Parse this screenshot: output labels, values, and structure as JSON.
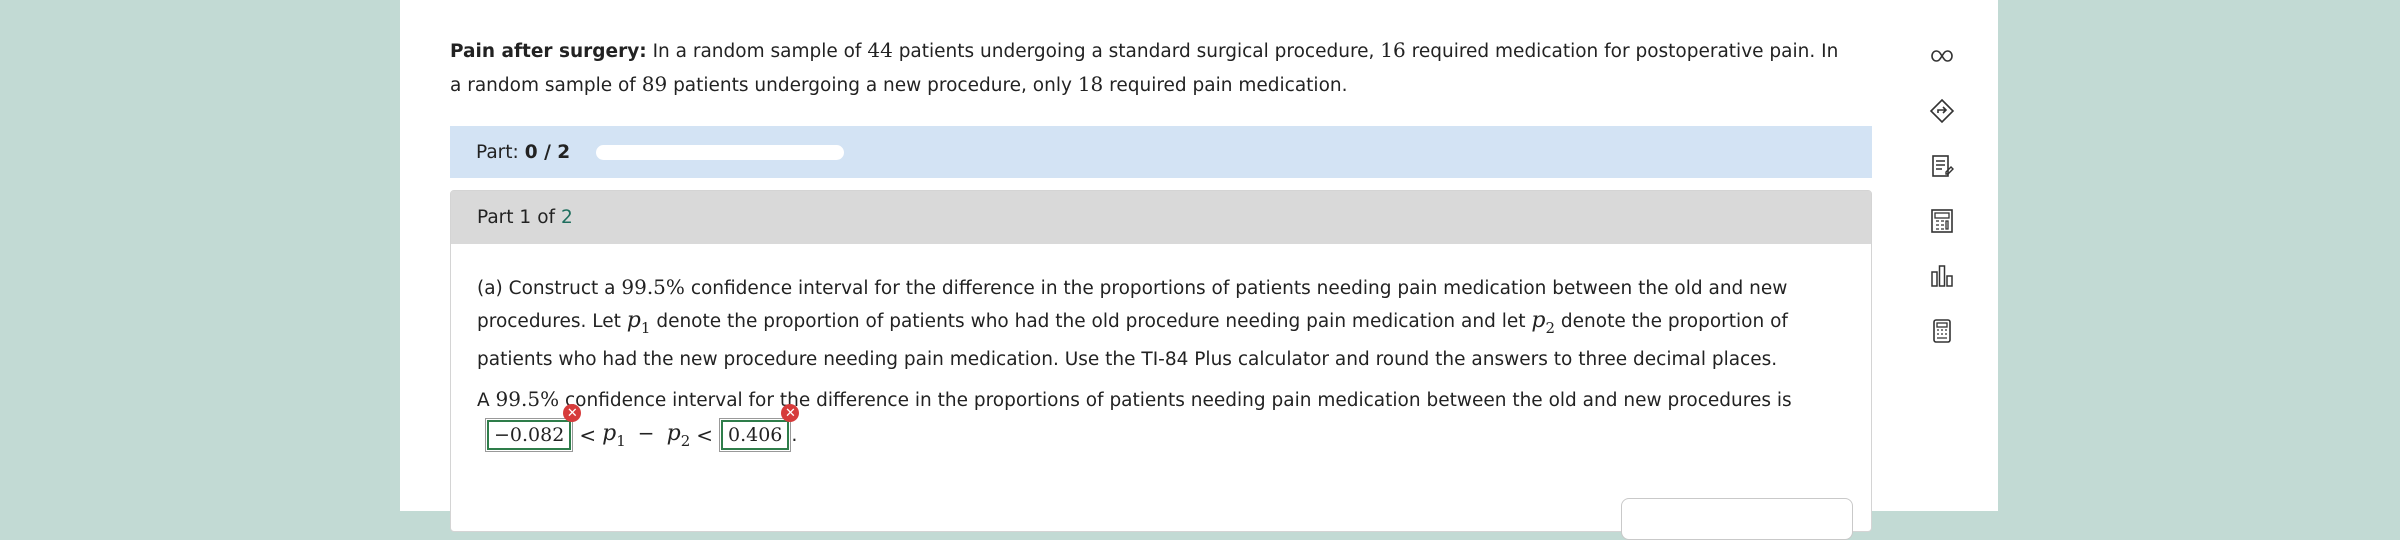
{
  "problem": {
    "title": "Pain after surgery:",
    "text_1": "In a random sample of",
    "n1": "44",
    "text_2": "patients undergoing a standard surgical procedure,",
    "x1": "16",
    "text_3": "required medication for postoperative pain. In a random sample of",
    "n2": "89",
    "text_4": "patients undergoing a new procedure, only",
    "x2": "18",
    "text_5": "required pain medication."
  },
  "part_bar": {
    "label": "Part:",
    "score": "0 / 2",
    "progress_fraction": 0
  },
  "part_card": {
    "part_label": "Part 1",
    "of_label": "of",
    "total": "2",
    "question": {
      "a_prefix": "(a) Construct a",
      "conf": "99.5%",
      "a_suffix": "confidence interval for the difference in the proportions of patients needing pain medication between the old and new procedures.",
      "let_word": "Let",
      "p_var": "p",
      "p1_sub": "1",
      "p1_desc": "denote the proportion of patients who had the old procedure needing pain medication and let",
      "p2_sub": "2",
      "p2_desc": "denote the proportion of patients who had the new procedure needing pain medication. Use the TI-84 Plus calculator and round the answers to three decimal places."
    },
    "answer": {
      "prefix": "A",
      "conf": "99.5%",
      "suffix": "confidence interval for the difference in the proportions of patients needing pain medication between the old and new procedures is",
      "lower": "−0.082",
      "upper": "0.406",
      "lt": "<",
      "minus": "−",
      "period": "."
    }
  },
  "tools": [
    "infinity-icon",
    "directions-icon",
    "notes-icon",
    "calculator-icon",
    "bar-chart-icon",
    "phone-calculator-icon"
  ],
  "colors": {
    "background": "#c2dad4",
    "part_bar": "#d3e3f4",
    "card_header": "#d9d9d9",
    "error": "#d63b3b",
    "answer_outline": "#2e7d4a",
    "accent_text": "#1f6e5e"
  }
}
